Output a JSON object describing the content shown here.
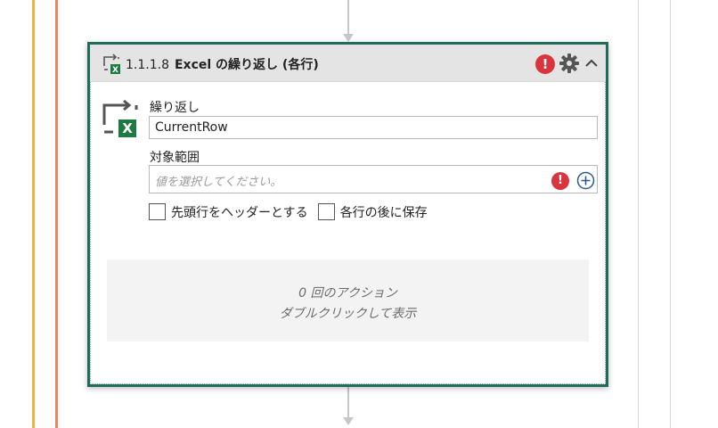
{
  "action": {
    "number": "1.1.1.8",
    "title": "Excel の繰り返し (各行)",
    "header_icons": [
      "excel-loop-icon",
      "error-icon",
      "gear-icon",
      "chevron-up-icon"
    ],
    "error_symbol": "!"
  },
  "fields": {
    "loop_label": "繰り返し",
    "loop_value": "CurrentRow",
    "range_label": "対象範囲",
    "range_placeholder": "値を選択してください。",
    "range_error_symbol": "!"
  },
  "checkboxes": [
    {
      "label": "先頭行をヘッダーとする",
      "checked": false
    },
    {
      "label": "各行の後に保存",
      "checked": false
    }
  ],
  "drop_zone": {
    "line1": "0 回のアクション",
    "line2": "ダブルクリックして表示"
  },
  "colors": {
    "accent_border": "#1f6b5c",
    "error": "#d9353f",
    "excel_green": "#1d7a45",
    "scope_yellow": "#E8B73D",
    "scope_orange": "#E58A5C"
  }
}
